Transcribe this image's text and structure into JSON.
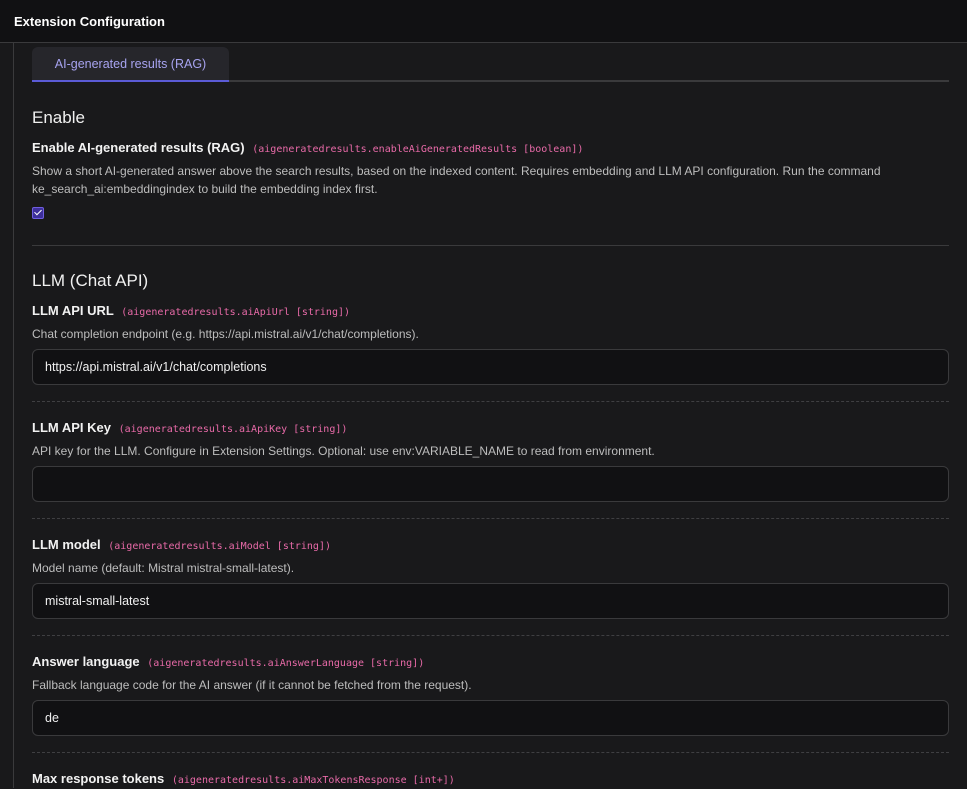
{
  "header": {
    "title": "Extension Configuration"
  },
  "tabs": [
    {
      "label": "AI-generated results (RAG)"
    }
  ],
  "sections": {
    "enable": {
      "title": "Enable",
      "field": {
        "label": "Enable AI-generated results (RAG)",
        "key": "(aigeneratedresults.enableAiGeneratedResults [boolean])",
        "description": "Show a short AI-generated answer above the search results, based on the indexed content. Requires embedding and LLM API configuration. Run the command ke_search_ai:embeddingindex to build the embedding index first.",
        "checked": true
      }
    },
    "llm": {
      "title": "LLM (Chat API)",
      "fields": [
        {
          "label": "LLM API URL",
          "key": "(aigeneratedresults.aiApiUrl [string])",
          "description": "Chat completion endpoint (e.g. https://api.mistral.ai/v1/chat/completions).",
          "value": "https://api.mistral.ai/v1/chat/completions"
        },
        {
          "label": "LLM API Key",
          "key": "(aigeneratedresults.aiApiKey [string])",
          "description": "API key for the LLM. Configure in Extension Settings. Optional: use env:VARIABLE_NAME to read from environment.",
          "value": ""
        },
        {
          "label": "LLM model",
          "key": "(aigeneratedresults.aiModel [string])",
          "description": "Model name (default: Mistral mistral-small-latest).",
          "value": "mistral-small-latest"
        },
        {
          "label": "Answer language",
          "key": "(aigeneratedresults.aiAnswerLanguage [string])",
          "description": "Fallback language code for the AI answer (if it cannot be fetched from the request).",
          "value": "de"
        },
        {
          "label": "Max response tokens",
          "key": "(aigeneratedresults.aiMaxTokensResponse [int+])"
        }
      ]
    }
  },
  "colors": {
    "background": "#19191b",
    "accent": "#5b5bd6",
    "key_text": "#e86aa8"
  }
}
